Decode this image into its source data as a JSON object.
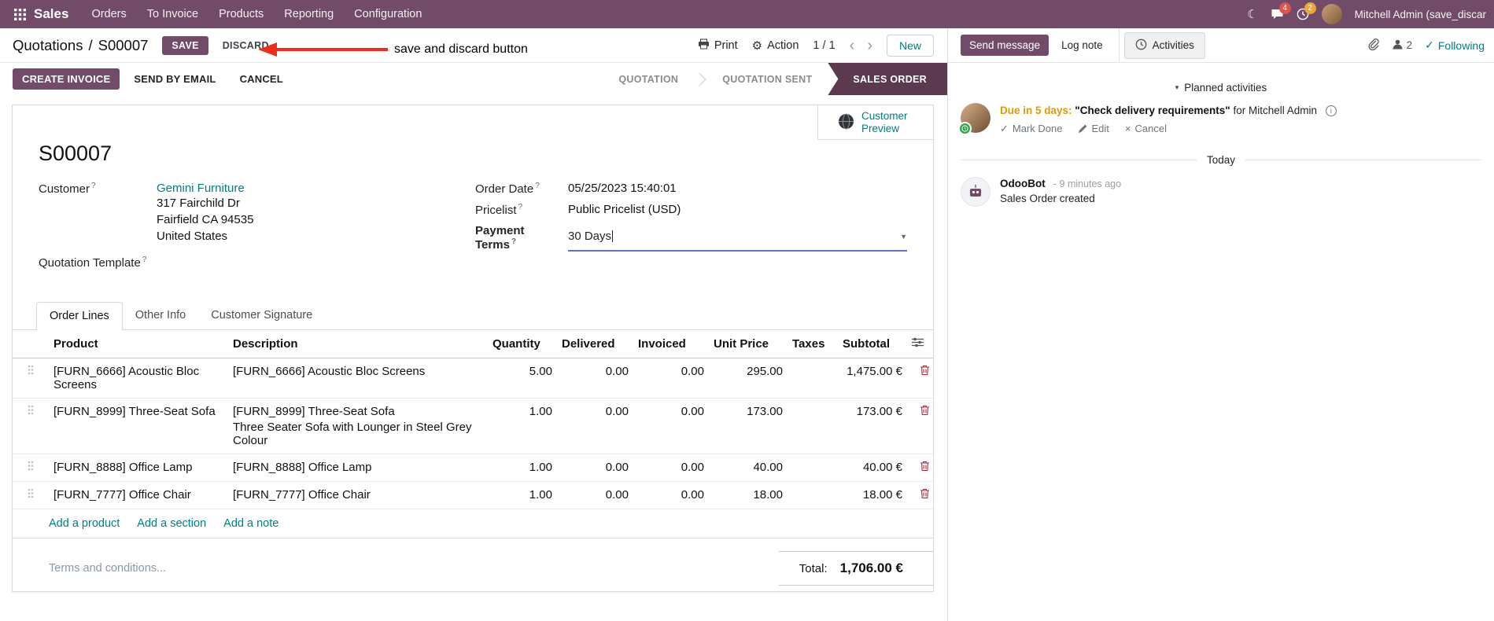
{
  "topbar": {
    "brand": "Sales",
    "menus": [
      "Orders",
      "To Invoice",
      "Products",
      "Reporting",
      "Configuration"
    ],
    "message_badge": "4",
    "activity_badge": "2",
    "user_name": "Mitchell Admin (save_discar"
  },
  "control_panel": {
    "breadcrumb_parent": "Quotations",
    "breadcrumb_sep": "/",
    "breadcrumb_current": "S00007",
    "save": "SAVE",
    "discard": "DISCARD",
    "print": "Print",
    "action": "Action",
    "pager": "1 / 1",
    "new": "New"
  },
  "annotation": {
    "label": "save and discard button"
  },
  "status": {
    "create_invoice": "CREATE INVOICE",
    "send_by_email": "SEND BY EMAIL",
    "cancel": "CANCEL",
    "stages": [
      "QUOTATION",
      "QUOTATION SENT",
      "SALES ORDER"
    ],
    "active_stage": "SALES ORDER"
  },
  "sheet": {
    "preview": "Customer Preview",
    "title": "S00007",
    "help_marker": "?",
    "customer": {
      "label": "Customer",
      "name": "Gemini Furniture",
      "address1": "317 Fairchild Dr",
      "address2": "Fairfield CA 94535",
      "address3": "United States"
    },
    "quotation_template_label": "Quotation Template",
    "order_date": {
      "label": "Order Date",
      "value": "05/25/2023 15:40:01"
    },
    "pricelist": {
      "label": "Pricelist",
      "value": "Public Pricelist (USD)"
    },
    "payment_terms": {
      "label": "Payment Terms",
      "value": "30 Days"
    },
    "tabs": {
      "order_lines": "Order Lines",
      "other_info": "Other Info",
      "customer_signature": "Customer Signature"
    },
    "table": {
      "headers": {
        "product": "Product",
        "description": "Description",
        "quantity": "Quantity",
        "delivered": "Delivered",
        "invoiced": "Invoiced",
        "unit_price": "Unit Price",
        "taxes": "Taxes",
        "subtotal": "Subtotal"
      },
      "rows": [
        {
          "product": "[FURN_6666] Acoustic Bloc Screens",
          "description": "[FURN_6666] Acoustic Bloc Screens",
          "quantity": "5.00",
          "delivered": "0.00",
          "invoiced": "0.00",
          "unit_price": "295.00",
          "taxes": "",
          "subtotal": "1,475.00 €"
        },
        {
          "product": "[FURN_8999] Three-Seat Sofa",
          "description": "[FURN_8999] Three-Seat Sofa",
          "description_note": "Three Seater Sofa with Lounger in Steel Grey Colour",
          "quantity": "1.00",
          "delivered": "0.00",
          "invoiced": "0.00",
          "unit_price": "173.00",
          "taxes": "",
          "subtotal": "173.00 €"
        },
        {
          "product": "[FURN_8888] Office Lamp",
          "description": "[FURN_8888] Office Lamp",
          "quantity": "1.00",
          "delivered": "0.00",
          "invoiced": "0.00",
          "unit_price": "40.00",
          "taxes": "",
          "subtotal": "40.00 €"
        },
        {
          "product": "[FURN_7777] Office Chair",
          "description": "[FURN_7777] Office Chair",
          "quantity": "1.00",
          "delivered": "0.00",
          "invoiced": "0.00",
          "unit_price": "18.00",
          "taxes": "",
          "subtotal": "18.00 €"
        }
      ],
      "add_product": "Add a product",
      "add_section": "Add a section",
      "add_note": "Add a note"
    },
    "terms_placeholder": "Terms and conditions...",
    "total_label": "Total:",
    "total_value": "1,706.00 €"
  },
  "chatter": {
    "send_message": "Send message",
    "log_note": "Log note",
    "activities": "Activities",
    "followers_count": "2",
    "following": "Following",
    "planned_title": "Planned activities",
    "activity": {
      "due": "Due in 5 days:",
      "summary": "\"Check delivery requirements\"",
      "assignee": "for Mitchell Admin",
      "mark_done": "Mark Done",
      "edit": "Edit",
      "cancel": "Cancel"
    },
    "date_divider": "Today",
    "message": {
      "author": "OdooBot",
      "time": "- 9 minutes ago",
      "body": "Sales Order created"
    }
  },
  "icons": {
    "dropdown": "▼",
    "prev": "‹",
    "next": "›",
    "check": "✓",
    "close": "×",
    "moon": "☾",
    "info": "i",
    "collapse": "▾",
    "gear": "⚙"
  }
}
